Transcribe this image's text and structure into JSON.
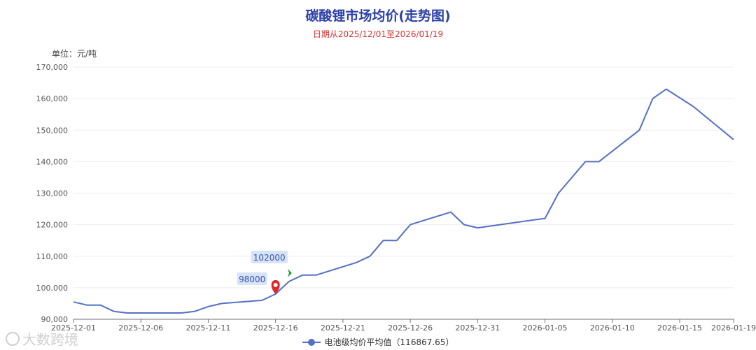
{
  "chart_data": {
    "type": "line",
    "title": "碳酸锂市场均价(走势图)",
    "subtitle": "日期从2025/12/01至2026/01/19",
    "unit_label": "单位：元/吨",
    "ylim": [
      90000,
      170000
    ],
    "y_ticks": [
      "90,000",
      "100,000",
      "110,000",
      "120,000",
      "130,000",
      "140,000",
      "150,000",
      "160,000",
      "170,000"
    ],
    "y_tick_values": [
      90000,
      100000,
      110000,
      120000,
      130000,
      140000,
      150000,
      160000,
      170000
    ],
    "x_tick_labels": [
      "2025-12-01",
      "2025-12-06",
      "2025-12-11",
      "2025-12-16",
      "2025-12-21",
      "2025-12-26",
      "2025-12-31",
      "2026-01-05",
      "2026-01-10",
      "2026-01-15",
      "2026-01-19"
    ],
    "grid": true,
    "legend_position": "bottom-center",
    "series": [
      {
        "name": "电池级均价平均值",
        "legend_label": "电池级均价平均值（116867.65）",
        "color": "#5470c6",
        "x": [
          "2025-12-01",
          "2025-12-02",
          "2025-12-03",
          "2025-12-04",
          "2025-12-05",
          "2025-12-09",
          "2025-12-10",
          "2025-12-11",
          "2025-12-12",
          "2025-12-15",
          "2025-12-16",
          "2025-12-17",
          "2025-12-18",
          "2025-12-19",
          "2025-12-22",
          "2025-12-23",
          "2025-12-24",
          "2025-12-25",
          "2025-12-26",
          "2025-12-29",
          "2025-12-30",
          "2025-12-31",
          "2026-01-05",
          "2026-01-06",
          "2026-01-08",
          "2026-01-09",
          "2026-01-12",
          "2026-01-13",
          "2026-01-14",
          "2026-01-16",
          "2026-01-19"
        ],
        "values": [
          95500,
          94500,
          94500,
          92500,
          92000,
          92000,
          92500,
          94000,
          95000,
          96000,
          98000,
          102000,
          104000,
          104000,
          108000,
          110000,
          115000,
          115000,
          120000,
          124000,
          120000,
          119000,
          122000,
          130000,
          140000,
          140000,
          150000,
          160000,
          163000,
          157500,
          147000
        ]
      }
    ],
    "annotations": [
      {
        "label": "98000",
        "x": "2025-12-16",
        "value": 98000,
        "marker": "red-pin"
      },
      {
        "label": "102000",
        "x": "2025-12-17",
        "value": 102000,
        "marker": "green-arrow"
      }
    ]
  },
  "watermark": {
    "text": "大数跨境",
    "logo_icon": "brand-logo-icon"
  }
}
